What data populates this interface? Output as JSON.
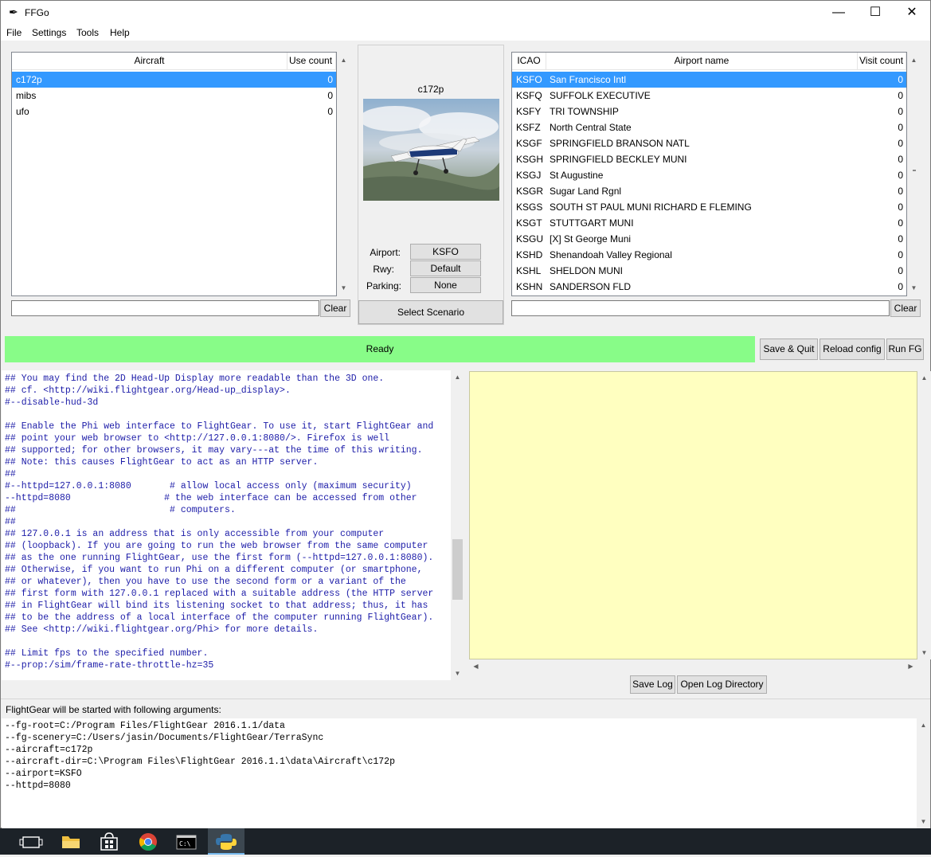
{
  "window": {
    "title": "FFGo",
    "minimize": "—",
    "maximize": "☐",
    "close": "✕"
  },
  "menu": [
    "File",
    "Settings",
    "Tools",
    "Help"
  ],
  "aircraft_panel": {
    "headers": {
      "name": "Aircraft",
      "count": "Use count"
    },
    "rows": [
      {
        "name": "c172p",
        "count": "0",
        "selected": true
      },
      {
        "name": "mibs",
        "count": "0",
        "selected": false
      },
      {
        "name": "ufo",
        "count": "0",
        "selected": false
      }
    ],
    "search_value": "",
    "clear_label": "Clear"
  },
  "scenario_panel": {
    "aircraft_name": "c172p",
    "airport_label": "Airport:",
    "airport_value": "KSFO",
    "rwy_label": "Rwy:",
    "rwy_value": "Default",
    "parking_label": "Parking:",
    "parking_value": "None",
    "select_scenario_label": "Select Scenario"
  },
  "airport_panel": {
    "headers": {
      "icao": "ICAO",
      "name": "Airport name",
      "count": "Visit count"
    },
    "rows": [
      {
        "icao": "KSFO",
        "name": "San Francisco Intl",
        "count": "0",
        "selected": true
      },
      {
        "icao": "KSFQ",
        "name": "SUFFOLK EXECUTIVE",
        "count": "0",
        "selected": false
      },
      {
        "icao": "KSFY",
        "name": "TRI TOWNSHIP",
        "count": "0",
        "selected": false
      },
      {
        "icao": "KSFZ",
        "name": "North Central State",
        "count": "0",
        "selected": false
      },
      {
        "icao": "KSGF",
        "name": "SPRINGFIELD BRANSON NATL",
        "count": "0",
        "selected": false
      },
      {
        "icao": "KSGH",
        "name": "SPRINGFIELD BECKLEY MUNI",
        "count": "0",
        "selected": false
      },
      {
        "icao": "KSGJ",
        "name": "St Augustine",
        "count": "0",
        "selected": false
      },
      {
        "icao": "KSGR",
        "name": "Sugar Land Rgnl",
        "count": "0",
        "selected": false
      },
      {
        "icao": "KSGS",
        "name": "SOUTH ST PAUL MUNI RICHARD E FLEMING",
        "count": "0",
        "selected": false
      },
      {
        "icao": "KSGT",
        "name": "STUTTGART MUNI",
        "count": "0",
        "selected": false
      },
      {
        "icao": "KSGU",
        "name": "[X] St George Muni",
        "count": "0",
        "selected": false
      },
      {
        "icao": "KSHD",
        "name": "Shenandoah Valley Regional",
        "count": "0",
        "selected": false
      },
      {
        "icao": "KSHL",
        "name": "SHELDON MUNI",
        "count": "0",
        "selected": false
      },
      {
        "icao": "KSHN",
        "name": "SANDERSON FLD",
        "count": "0",
        "selected": false
      }
    ],
    "search_value": "",
    "clear_label": "Clear"
  },
  "status": {
    "text": "Ready",
    "color": "#88fc88"
  },
  "actions": {
    "save_quit": "Save & Quit",
    "reload_config": "Reload config",
    "run_fg": "Run FG"
  },
  "config_text": [
    "## You may find the 2D Head-Up Display more readable than the 3D one.",
    "## cf. <http://wiki.flightgear.org/Head-up_display>.",
    "#--disable-hud-3d",
    "",
    "## Enable the Phi web interface to FlightGear. To use it, start FlightGear and",
    "## point your web browser to <http://127.0.0.1:8080/>. Firefox is well",
    "## supported; for other browsers, it may vary---at the time of this writing.",
    "## Note: this causes FlightGear to act as an HTTP server.",
    "##",
    "#--httpd=127.0.0.1:8080       # allow local access only (maximum security)",
    "--httpd=8080                 # the web interface can be accessed from other",
    "##                            # computers.",
    "##",
    "## 127.0.0.1 is an address that is only accessible from your computer",
    "## (loopback). If you are going to run the web browser from the same computer",
    "## as the one running FlightGear, use the first form (--httpd=127.0.0.1:8080).",
    "## Otherwise, if you want to run Phi on a different computer (or smartphone,",
    "## or whatever), then you have to use the second form or a variant of the",
    "## first form with 127.0.0.1 replaced with a suitable address (the HTTP server",
    "## in FlightGear will bind its listening socket to that address; thus, it has",
    "## to be the address of a local interface of the computer running FlightGear).",
    "## See <http://wiki.flightgear.org/Phi> for more details.",
    "",
    "## Limit fps to the specified number.",
    "#--prop:/sim/frame-rate-throttle-hz=35"
  ],
  "log_panel": {
    "background": "#ffffc0",
    "save_log": "Save Log",
    "open_log_dir": "Open Log Directory"
  },
  "arguments": {
    "header": "FlightGear will be started with following arguments:",
    "lines": [
      "--fg-root=C:/Program Files/FlightGear 2016.1.1/data",
      "--fg-scenery=C:/Users/jasin/Documents/FlightGear/TerraSync",
      "--aircraft=c172p",
      "--aircraft-dir=C:\\Program Files\\FlightGear 2016.1.1\\data\\Aircraft\\c172p",
      "--airport=KSFO",
      "--httpd=8080"
    ]
  },
  "taskbar": {
    "icons": [
      "task-view-icon",
      "file-explorer-icon",
      "store-icon",
      "chrome-icon",
      "command-prompt-icon",
      "python-icon"
    ]
  }
}
